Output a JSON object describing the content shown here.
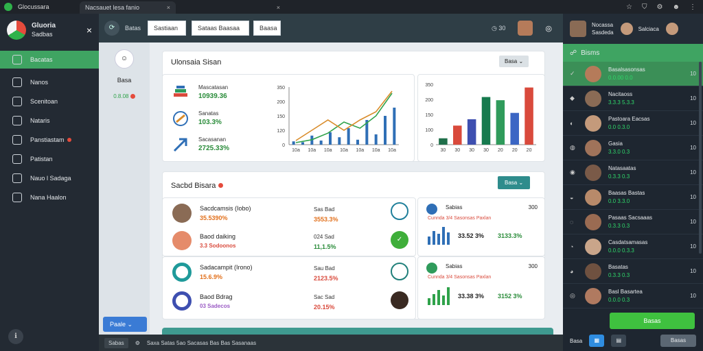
{
  "chrome": {
    "brand": "Glocussara",
    "tab_active": "Nacsauet lesa fanio",
    "tab_inactive": "",
    "close": "×"
  },
  "sidebar": {
    "title": "Gluoria",
    "subtitle": "Sadbas",
    "items": [
      {
        "label": "Bacatas"
      },
      {
        "label": "Nanos"
      },
      {
        "label": "Scenitoan"
      },
      {
        "label": "Nataris"
      },
      {
        "label": "Panstiastam"
      },
      {
        "label": "Patistan"
      },
      {
        "label": "Nauo l Sadaga"
      },
      {
        "label": "Nana Haalon"
      }
    ]
  },
  "topbar": {
    "label": "Batas",
    "input1": "Sastiaan",
    "input2": "Sataas Baasaa",
    "input3": "Baasa",
    "clock": "30"
  },
  "col2": {
    "name": "Basa",
    "stat": "0.8.08"
  },
  "card1": {
    "title": "Ulonsaia Sisan",
    "button": "Basa",
    "metrics": [
      {
        "label": "Mascatasan",
        "value": "10939.36"
      },
      {
        "label": "Sanatas",
        "value": "103.3%"
      },
      {
        "label": "Sacasanan",
        "value": "2725.33%"
      }
    ]
  },
  "card2": {
    "title": "Sacbd Bisara",
    "button": "Basa",
    "rows": [
      {
        "name": "Sacdcamsis (Iobo)",
        "pct": "35.5390%",
        "lbl": "Sas Bad",
        "val": "3553.3%"
      },
      {
        "name": "Baod daiking",
        "pct": "3.3 Sodoonos",
        "lbl": "024 Sad",
        "val": "11,1.5%"
      },
      {
        "name": "Sadacampit (Irono)",
        "pct": "15.6.9%",
        "lbl": "Sau Bad",
        "val": "2123.5%"
      },
      {
        "name": "Baod Bdrag",
        "pct": "03 Sadecos",
        "lbl": "Sac Sad",
        "val": "20.15%"
      }
    ],
    "side": [
      {
        "title": "Sabias",
        "num": "300",
        "sub": "Cunnda 3/4 Sasonsas Paxlan",
        "v1": "33.52 3%",
        "v2": "3133.3%"
      },
      {
        "title": "Sabias",
        "num": "300",
        "sub": "Cunnda 3/4 Sasonsas Paxlan",
        "v1": "33.38 3%",
        "v2": "3152 3%"
      }
    ]
  },
  "bottombar": {
    "pill": "Sabas",
    "msg": "Saxa Satas 5ao Sacasas Bas Bas Sasanaas"
  },
  "col2_drop": "Paale",
  "rpanel": {
    "user": "Nocassa",
    "user_sub": "Sasdeda",
    "user2": "Salciaca",
    "header": "Bisms",
    "rows": [
      {
        "name": "Basalsasonsas",
        "sub": "0.0.00 0.0",
        "num": "10"
      },
      {
        "name": "Nacitaoss",
        "sub": "3.3.3 5.3.3",
        "num": "10"
      },
      {
        "name": "Pastoara Eacsas",
        "sub": "0.0 0.3.0",
        "num": "10"
      },
      {
        "name": "Gasia",
        "sub": "3.3.0 0.3",
        "num": "10"
      },
      {
        "name": "Natasaatas",
        "sub": "0.3.3 0.3",
        "num": "10"
      },
      {
        "name": "Baasas Bastas",
        "sub": "0.0 3.3.0",
        "num": "10"
      },
      {
        "name": "Pasaas Sacsaaas",
        "sub": "0.3.3 0.3",
        "num": "10"
      },
      {
        "name": "Casdatsamasas",
        "sub": "0.0.0 0.3.3",
        "num": "10"
      },
      {
        "name": "Basatas",
        "sub": "0.3.3 0.3",
        "num": "10"
      },
      {
        "name": "Basl Basartea",
        "sub": "0.0.0 0.3",
        "num": "10"
      }
    ],
    "green_btn": "Basas",
    "footer_label": "Basa",
    "footer_btn": "Basas"
  },
  "chart_data": [
    {
      "type": "line",
      "y_ticks": [
        "350",
        "200",
        "150",
        "120",
        "0"
      ],
      "x_ticks": [
        "10a",
        "10a",
        "10a",
        "10a",
        "10a",
        "10a",
        "10a"
      ],
      "series": [
        {
          "values": [
            5,
            12,
            28,
            55,
            40,
            70,
            125
          ]
        },
        {
          "values": [
            10,
            35,
            60,
            35,
            60,
            80,
            130
          ]
        }
      ],
      "bars": [
        8,
        6,
        22,
        10,
        30,
        18,
        40,
        12,
        60,
        25,
        70,
        90
      ],
      "colors": {
        "line1": "#2fa24a",
        "line2": "#d98c2b",
        "bars": "#2f6fb6"
      }
    },
    {
      "type": "bar",
      "y_ticks": [
        "350",
        "200",
        "150",
        "100",
        "0"
      ],
      "x_ticks": [
        "30",
        "30",
        "30",
        "30",
        "20",
        "20",
        "20"
      ],
      "series": [
        {
          "name": "",
          "values": [
            20,
            60,
            80,
            150,
            140,
            100,
            180
          ]
        }
      ],
      "colors": [
        "#1f6f4a",
        "#d94a3c",
        "#3e4fb0",
        "#167a4e",
        "#2f9b5b",
        "#3b66c4",
        "#d94a3c"
      ]
    }
  ]
}
